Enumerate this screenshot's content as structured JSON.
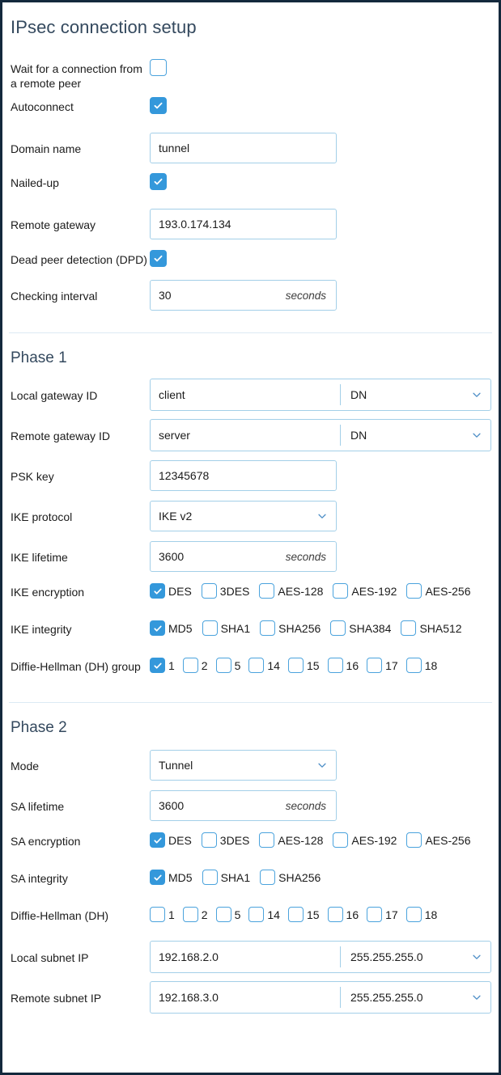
{
  "page_title": "IPsec connection setup",
  "colors": {
    "accent": "#3498db",
    "border_input": "#a3cfe8",
    "frame": "#14293d",
    "title_text": "#34495e",
    "divider": "#dceaf4"
  },
  "general": {
    "wait_for_connection": {
      "label": "Wait for a connection from a remote peer",
      "checked": false
    },
    "autoconnect": {
      "label": "Autoconnect",
      "checked": true
    },
    "domain_name": {
      "label": "Domain name",
      "value": "tunnel"
    },
    "nailed_up": {
      "label": "Nailed-up",
      "checked": true
    },
    "remote_gateway": {
      "label": "Remote gateway",
      "value": "193.0.174.134"
    },
    "dpd": {
      "label": "Dead peer detection (DPD)",
      "checked": true
    },
    "checking_interval": {
      "label": "Checking interval",
      "value": "30",
      "unit": "seconds"
    }
  },
  "phase1": {
    "title": "Phase 1",
    "local_gateway_id": {
      "label": "Local gateway ID",
      "value": "client",
      "type": "DN"
    },
    "remote_gateway_id": {
      "label": "Remote gateway ID",
      "value": "server",
      "type": "DN"
    },
    "psk_key": {
      "label": "PSK key",
      "value": "12345678"
    },
    "ike_protocol": {
      "label": "IKE protocol",
      "value": "IKE v2"
    },
    "ike_lifetime": {
      "label": "IKE lifetime",
      "value": "3600",
      "unit": "seconds"
    },
    "ike_encryption": {
      "label": "IKE encryption",
      "options": [
        {
          "label": "DES",
          "checked": true
        },
        {
          "label": "3DES",
          "checked": false
        },
        {
          "label": "AES-128",
          "checked": false
        },
        {
          "label": "AES-192",
          "checked": false
        },
        {
          "label": "AES-256",
          "checked": false
        }
      ]
    },
    "ike_integrity": {
      "label": "IKE integrity",
      "options": [
        {
          "label": "MD5",
          "checked": true
        },
        {
          "label": "SHA1",
          "checked": false
        },
        {
          "label": "SHA256",
          "checked": false
        },
        {
          "label": "SHA384",
          "checked": false
        },
        {
          "label": "SHA512",
          "checked": false
        }
      ]
    },
    "dh_group": {
      "label": "Diffie-Hellman (DH) group",
      "options": [
        {
          "label": "1",
          "checked": true
        },
        {
          "label": "2",
          "checked": false
        },
        {
          "label": "5",
          "checked": false
        },
        {
          "label": "14",
          "checked": false
        },
        {
          "label": "15",
          "checked": false
        },
        {
          "label": "16",
          "checked": false
        },
        {
          "label": "17",
          "checked": false
        },
        {
          "label": "18",
          "checked": false
        }
      ]
    }
  },
  "phase2": {
    "title": "Phase 2",
    "mode": {
      "label": "Mode",
      "value": "Tunnel"
    },
    "sa_lifetime": {
      "label": "SA lifetime",
      "value": "3600",
      "unit": "seconds"
    },
    "sa_encryption": {
      "label": "SA encryption",
      "options": [
        {
          "label": "DES",
          "checked": true
        },
        {
          "label": "3DES",
          "checked": false
        },
        {
          "label": "AES-128",
          "checked": false
        },
        {
          "label": "AES-192",
          "checked": false
        },
        {
          "label": "AES-256",
          "checked": false
        }
      ]
    },
    "sa_integrity": {
      "label": "SA integrity",
      "options": [
        {
          "label": "MD5",
          "checked": true
        },
        {
          "label": "SHA1",
          "checked": false
        },
        {
          "label": "SHA256",
          "checked": false
        }
      ]
    },
    "dh_group": {
      "label": "Diffie-Hellman (DH)",
      "options": [
        {
          "label": "1",
          "checked": false
        },
        {
          "label": "2",
          "checked": false
        },
        {
          "label": "5",
          "checked": false
        },
        {
          "label": "14",
          "checked": false
        },
        {
          "label": "15",
          "checked": false
        },
        {
          "label": "16",
          "checked": false
        },
        {
          "label": "17",
          "checked": false
        },
        {
          "label": "18",
          "checked": false
        }
      ]
    },
    "local_subnet_ip": {
      "label": "Local subnet IP",
      "value": "192.168.2.0",
      "mask": "255.255.255.0"
    },
    "remote_subnet_ip": {
      "label": "Remote subnet IP",
      "value": "192.168.3.0",
      "mask": "255.255.255.0"
    }
  }
}
